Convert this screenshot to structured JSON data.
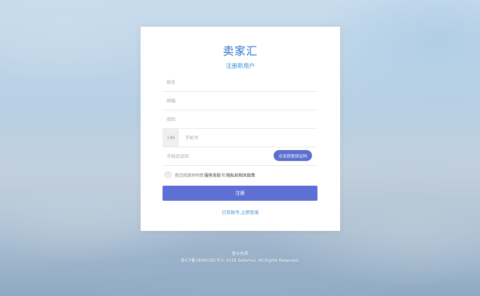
{
  "brand": {
    "logo_text": "卖家汇"
  },
  "form": {
    "title": "注册新用户",
    "name_placeholder": "姓名",
    "email_placeholder": "邮箱",
    "password_placeholder": "密码",
    "phone_prefix": "+86",
    "phone_placeholder": "手机号",
    "sms_code_placeholder": "手机验证码",
    "sms_button_label": "点击获取验证码",
    "agree_prefix": "我已阅读并同意",
    "terms_link": "服务条款",
    "agree_and": "和",
    "privacy_link": "隐私权相关政策",
    "submit_label": "注册",
    "login_link": "已有账号,立即登录"
  },
  "footer": {
    "license_link": "营业执照",
    "copyright": "粤ICP备18080381号© 2018 Sellerhui. All Rights Reserved."
  },
  "colors": {
    "primary": "#5f70d4",
    "link": "#4a8fd8",
    "logo": "#2a6fc9"
  }
}
